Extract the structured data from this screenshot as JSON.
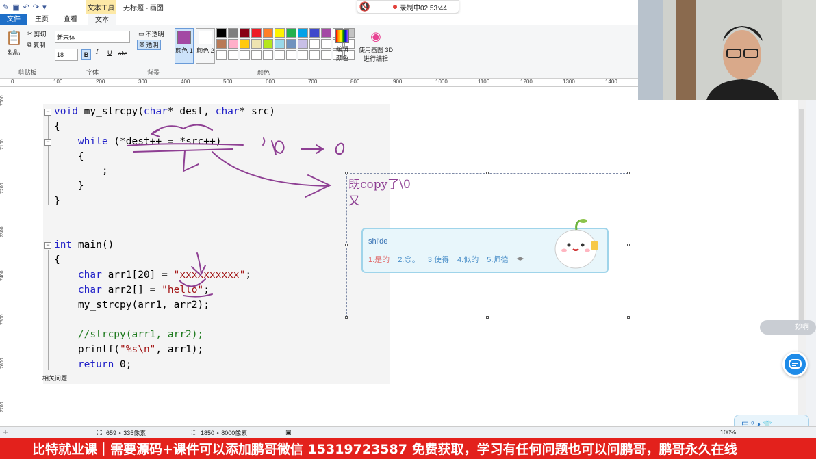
{
  "titlebar": {
    "context_tab": "文本工具",
    "title": "无标题 - 画图"
  },
  "recording": {
    "label": "录制中02:53:44"
  },
  "tabs": {
    "file": "文件",
    "home": "主页",
    "view": "查看",
    "text": "文本"
  },
  "ribbon": {
    "paste": "粘贴",
    "cut": "剪切",
    "copy": "复制",
    "clipboard_group": "剪贴板",
    "font_name": "新宋体",
    "font_size": "18",
    "font_group": "字体",
    "bold": "B",
    "italic": "I",
    "underline": "U",
    "strike": "abc",
    "opaque": "不透明",
    "transparent": "透明",
    "background_group": "背景",
    "color1": "颜色 1",
    "color2": "颜色 2",
    "edit_colors": "编辑颜色",
    "paint3d": "使用画图 3D 进行编辑",
    "colors_group": "颜色",
    "palette": [
      "#000000",
      "#7f7f7f",
      "#880015",
      "#ed1c24",
      "#ff7f27",
      "#fff200",
      "#22b14c",
      "#00a2e8",
      "#3f48cc",
      "#a349a4",
      "#ffffff",
      "#c3c3c3",
      "#b97a57",
      "#ffaec9",
      "#ffc90e",
      "#efe4b0",
      "#b5e61d",
      "#99d9ea",
      "#7092be",
      "#c8bfe7"
    ],
    "color1_value": "#a349a4"
  },
  "ruler": {
    "ticks": [
      "0",
      "100",
      "200",
      "300",
      "400",
      "500",
      "600",
      "700",
      "800",
      "900",
      "1000",
      "1100",
      "1200",
      "1300",
      "1400"
    ]
  },
  "vruler": {
    "ticks": [
      "7000",
      "7100",
      "7200",
      "7300",
      "7400",
      "7500",
      "7600",
      "7700"
    ]
  },
  "code": {
    "l1a": "void",
    "l1b": " my_strcpy(",
    "l1c": "char",
    "l1d": "* dest, ",
    "l1e": "char",
    "l1f": "* src)",
    "l2": "{",
    "l3a": "    while",
    "l3b": " (*dest++ = *src++)",
    "l4": "    {",
    "l5": "        ;",
    "l6": "    }",
    "l7": "}",
    "l8a": "int",
    "l8b": " main()",
    "l9": "{",
    "l10a": "    char",
    "l10b": " arr1[20] = ",
    "l10c": "\"xxxxxxxxxx\"",
    "l10d": ";",
    "l11a": "    char",
    "l11b": " arr2[] = ",
    "l11c": "\"hello\"",
    "l11d": ";",
    "l12": "    my_strcpy(arr1, arr2);",
    "l13": "    //strcpy(arr1, arr2);",
    "l14a": "    printf(",
    "l14b": "\"%s\\n\"",
    "l14c": ", arr1);",
    "l15a": "    return",
    "l15b": " 0;",
    "bottom": "相关问题"
  },
  "annotation": {
    "hand_text": "'\\0' → 0",
    "typed_line1": "既copy了\\0",
    "typed_line2": "又"
  },
  "ime": {
    "pinyin": "shi'de",
    "candidates": [
      "1.是的",
      "2.😊。",
      "3.使得",
      "4.似的",
      "5.师德"
    ]
  },
  "status": {
    "selection": "659 × 335像素",
    "canvas": "1850 × 8000像素",
    "zoom": "100%"
  },
  "chat": {
    "bubble": "妙啊"
  },
  "ime_bar": {
    "label": "中 ⁰ ◑ 👕"
  },
  "banner": {
    "text": "比特就业课｜需要源码+课件可以添加鹏哥微信 15319723587 免费获取，学习有任何问题也可以问鹏哥，鹏哥永久在线"
  }
}
